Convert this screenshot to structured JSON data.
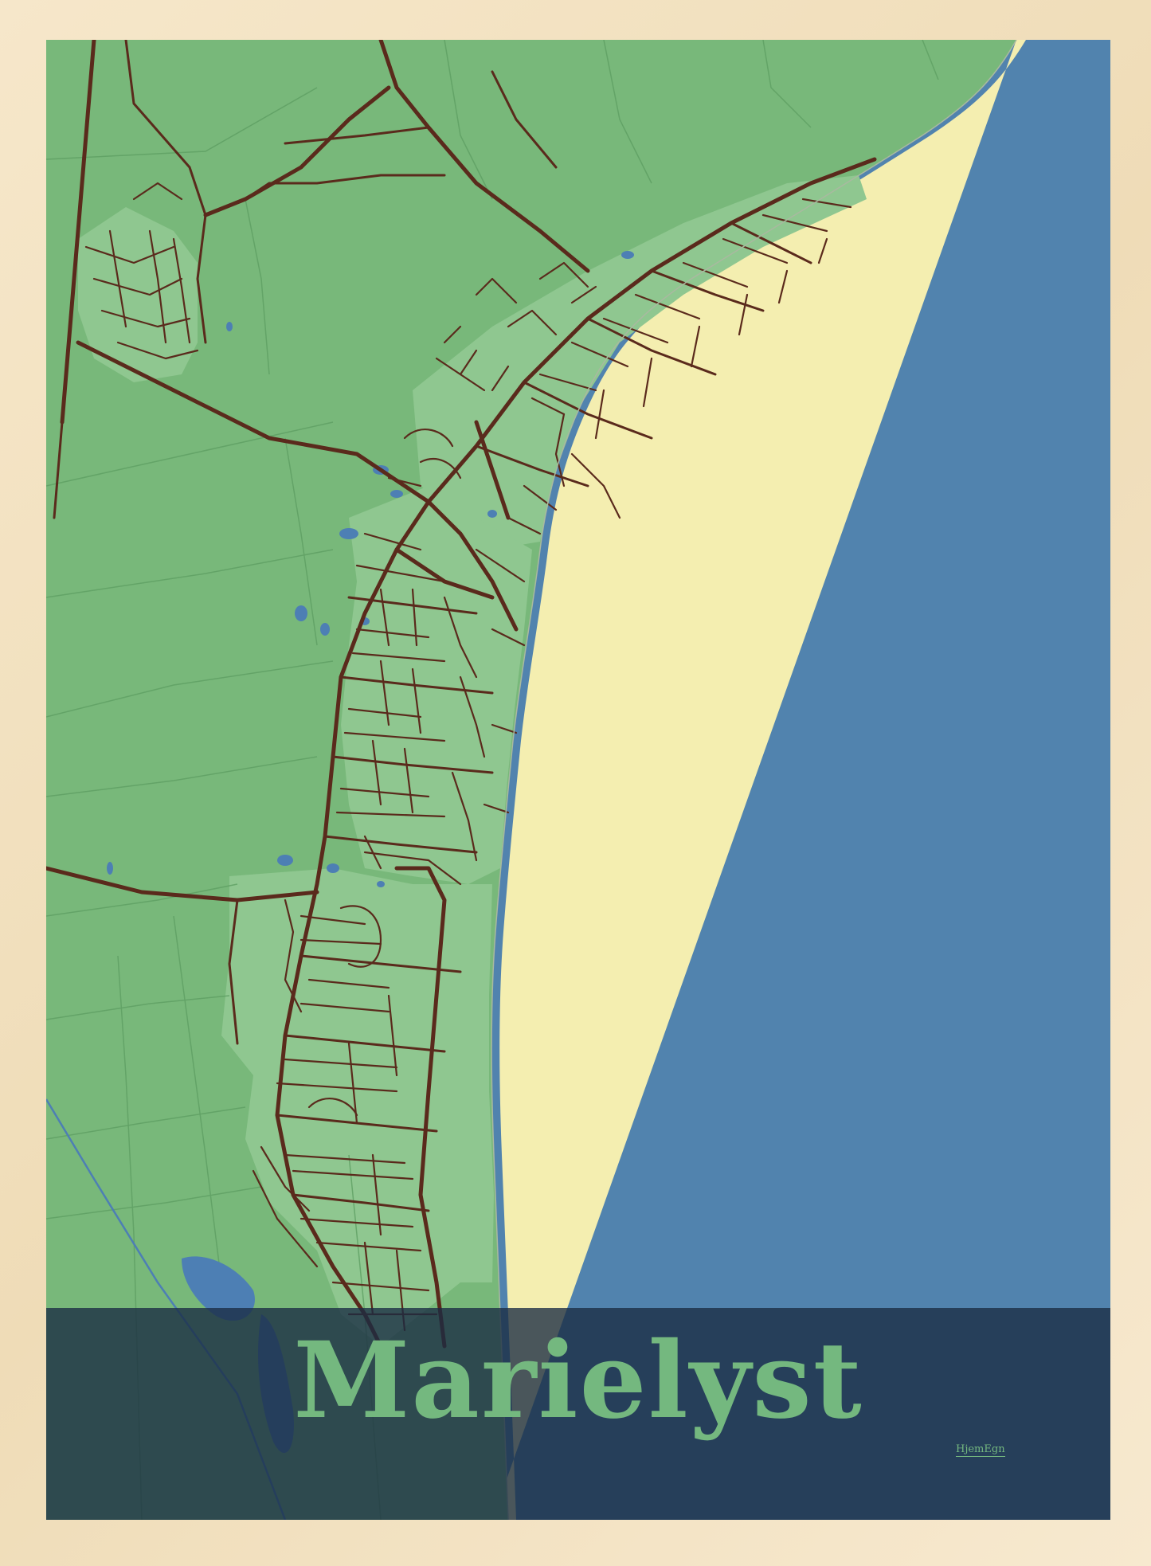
{
  "poster": {
    "town_name": "Marielyst",
    "brand": "HjemEgn"
  },
  "colors": {
    "sea": "#5183ae",
    "land": "#78b87a",
    "urban": "#8fc790",
    "beach": "#f4eeb0",
    "roads": "#5a2a1c",
    "lakes": "#4d7fb4",
    "band": "#1a2c42",
    "title": "#74b87f",
    "frame": "#f1ddb9"
  }
}
